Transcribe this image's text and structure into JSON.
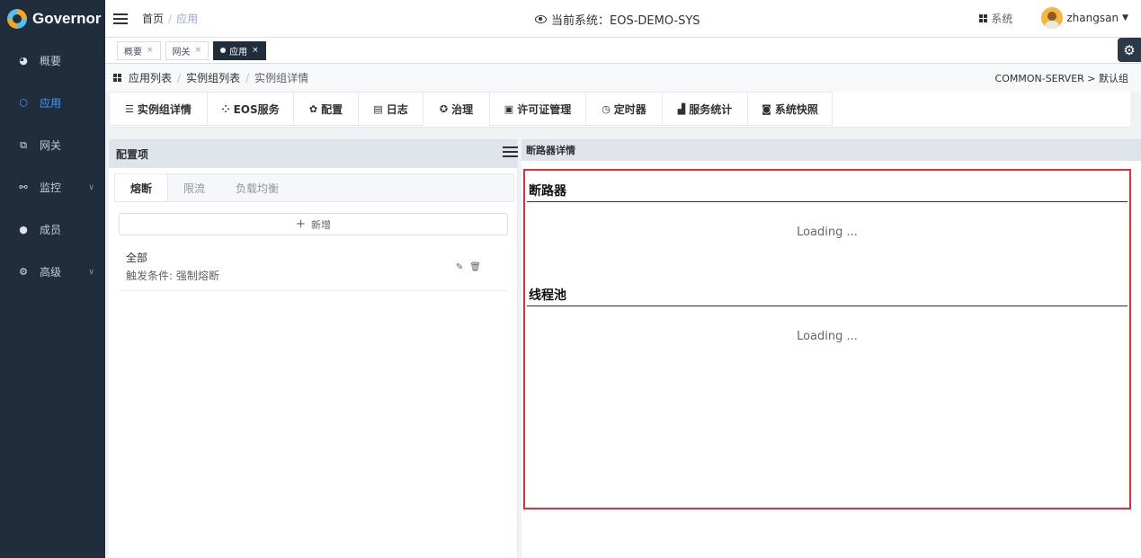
{
  "app": {
    "title": "Governor"
  },
  "sidebar": {
    "items": [
      {
        "label": "概要",
        "icon": "dashboard-icon"
      },
      {
        "label": "应用",
        "icon": "cube-icon",
        "active": true
      },
      {
        "label": "网关",
        "icon": "gateway-icon"
      },
      {
        "label": "监控",
        "icon": "monitor-icon"
      },
      {
        "label": "成员",
        "icon": "user-icon"
      },
      {
        "label": "高级",
        "icon": "gears-icon"
      }
    ]
  },
  "header": {
    "breadcrumb": [
      "首页",
      "应用"
    ],
    "current_system": "当前系统：EOS-DEMO-SYS",
    "system_button": "系统",
    "username": "zhangsan"
  },
  "tags": [
    {
      "label": "概要"
    },
    {
      "label": "网关"
    },
    {
      "label": "应用",
      "active": true
    }
  ],
  "subcrumb": {
    "items": [
      "应用列表",
      "实例组列表",
      "实例组详情"
    ],
    "right": "COMMON-SERVER > 默认组"
  },
  "tabs": [
    {
      "label": "实例组详情",
      "icon": "list-icon"
    },
    {
      "label": "EOS服务",
      "icon": "cluster-icon"
    },
    {
      "label": "配置",
      "icon": "gear-icon"
    },
    {
      "label": "日志",
      "icon": "log-icon"
    },
    {
      "label": "治理",
      "icon": "govern-icon",
      "active": true
    },
    {
      "label": "许可证管理",
      "icon": "license-icon"
    },
    {
      "label": "定时器",
      "icon": "clock-icon"
    },
    {
      "label": "服务统计",
      "icon": "bar-chart-icon"
    },
    {
      "label": "系统快照",
      "icon": "camera-icon"
    }
  ],
  "left_panel": {
    "title": "配置项",
    "inner_tabs": [
      "熔断",
      "限流",
      "负载均衡"
    ],
    "add_label": "新增",
    "rules": [
      {
        "title": "全部",
        "desc": "触发条件: 强制熔断"
      }
    ]
  },
  "right_panel": {
    "title": "断路器详情",
    "sections": [
      {
        "title": "断路器",
        "status": "Loading ..."
      },
      {
        "title": "线程池",
        "status": "Loading ..."
      }
    ]
  },
  "colors": {
    "sidebar_bg": "#1f2d3d",
    "accent": "#409eff",
    "highlight_border": "#e0303a"
  }
}
